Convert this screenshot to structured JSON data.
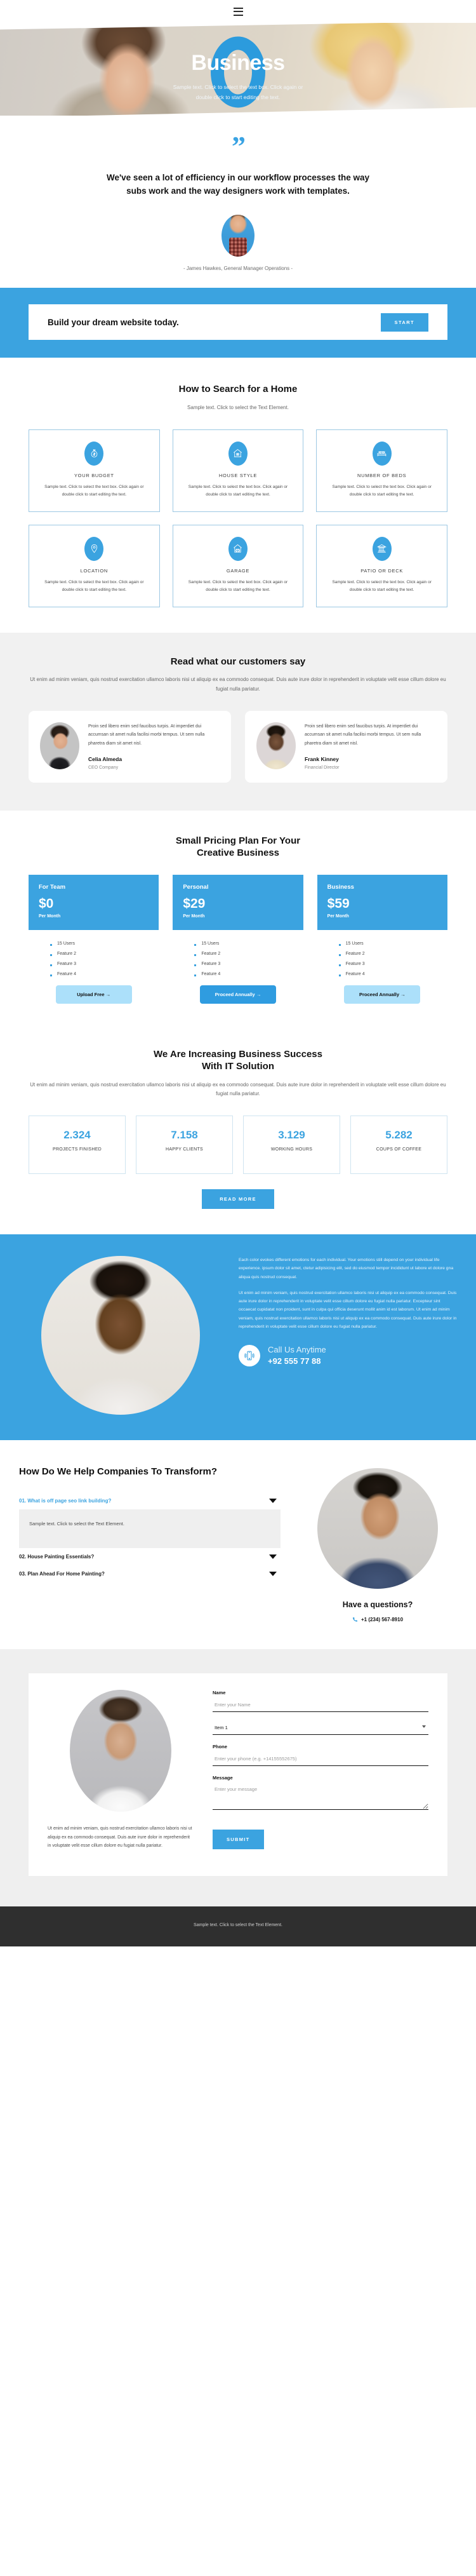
{
  "nav": {
    "menu_icon": "hamburger-menu-icon"
  },
  "hero": {
    "title": "Business",
    "subtitle": "Sample text. Click to select the text box. Click again or double click to start editing the text."
  },
  "quote": {
    "mark": "”",
    "text": "We've seen a lot of efficiency in our workflow processes the way subs work and the way designers work with templates.",
    "author": "- James Hawkes, General Manager Operations -"
  },
  "cta": {
    "text": "Build your dream website today.",
    "button": "START"
  },
  "features": {
    "title": "How to Search for a Home",
    "subtitle": "Sample text. Click to select the Text Element.",
    "body": "Sample text. Click to select the text box. Click again or double click to start editing the text.",
    "items": [
      {
        "icon": "money-bag-icon",
        "title": "YOUR BUDGET"
      },
      {
        "icon": "house-icon",
        "title": "HOUSE STYLE"
      },
      {
        "icon": "bed-icon",
        "title": "NUMBER OF BEDS"
      },
      {
        "icon": "map-pin-icon",
        "title": "LOCATION"
      },
      {
        "icon": "garage-car-icon",
        "title": "GARAGE"
      },
      {
        "icon": "patio-columns-icon",
        "title": "PATIO OR DECK"
      }
    ]
  },
  "testimonials": {
    "title": "Read what our customers say",
    "subtitle": "Ut enim ad minim veniam, quis nostrud exercitation ullamco laboris nisi ut aliquip ex ea commodo consequat. Duis aute irure dolor in reprehenderit in voluptate velit esse cillum dolore eu fugiat nulla pariatur.",
    "items": [
      {
        "text": "Proin sed libero enim sed faucibus turpis. At imperdiet dui accumsan sit amet nulla facilisi morbi tempus. Ut sem nulla pharetra diam sit amet nisl.",
        "name": "Celia Almeda",
        "role": "CEO Company"
      },
      {
        "text": "Proin sed libero enim sed faucibus turpis. At imperdiet dui accumsan sit amet nulla facilisi morbi tempus. Ut sem nulla pharetra diam sit amet nisl.",
        "name": "Frank Kinney",
        "role": "Financial Director"
      }
    ]
  },
  "pricing": {
    "title": "Small Pricing Plan For Your\nCreative Business",
    "plans": [
      {
        "name": "For Team",
        "price": "$0",
        "period": "Per Month",
        "features": [
          "15 Users",
          "Feature 2",
          "Feature 3",
          "Feature 4"
        ],
        "button": "Upload Free →"
      },
      {
        "name": "Personal",
        "price": "$29",
        "period": "Per Month",
        "features": [
          "15 Users",
          "Feature 2",
          "Feature 3",
          "Feature 4"
        ],
        "button": "Proceed Annually →"
      },
      {
        "name": "Business",
        "price": "$59",
        "period": "Per Month",
        "features": [
          "15 Users",
          "Feature 2",
          "Feature 3",
          "Feature 4"
        ],
        "button": "Proceed Annually →"
      }
    ]
  },
  "stats": {
    "title": "We Are Increasing Business Success\nWith IT Solution",
    "subtitle": "Ut enim ad minim veniam, quis nostrud exercitation ullamco laboris nisi ut aliquip ex ea commodo consequat. Duis aute irure dolor in reprehenderit in voluptate velit esse cillum dolore eu fugiat nulla pariatur.",
    "items": [
      {
        "value": "2.324",
        "label": "PROJECTS FINISHED"
      },
      {
        "value": "7.158",
        "label": "HAPPY CLIENTS"
      },
      {
        "value": "3.129",
        "label": "WORKING HOURS"
      },
      {
        "value": "5.282",
        "label": "COUPS OF COFFEE"
      }
    ],
    "button": "READ MORE"
  },
  "about": {
    "paragraph1": "Each color evokes different emotions for each individual. Your emotions still depend on your individual life experience. ipsum dolor sit amet, ctetur adipisicing elit, sed do eiusmod tempor incididunt ut labore et dolore gna aliqua quis nostrud consequat.",
    "paragraph2": "Ut enim ad minim veniam, quis nostrud exercitation ullamco laboris nisi ut aliquip ex ea commodo consequat. Duis aute irure dolor in reprehenderit in voluptate velit esse cillum dolore eu fugiat nulla pariatur. Excepteur sint occaecat cupidatat non proident, sunt in culpa qui officia deserunt mollit anim id est laborum. Ut enim ad minim veniam, quis nostrud exercitation ullamco laboris nisi ut aliquip ex ea commodo consequat. Duis aute irure dolor in reprehenderit in voluptate velit esse cillum dolore eu fugiat nulla pariatur.",
    "call_label": "Call Us Anytime",
    "call_number": "+92 555 77 88",
    "call_icon": "mobile-phone-ringing-icon"
  },
  "faq": {
    "title": "How Do We Help Companies To Transform?",
    "items": [
      {
        "question": "01. What is off page seo link building?",
        "open": true,
        "answer": "Sample text. Click to select the Text Element."
      },
      {
        "question": "02. House Painting Essentials?",
        "open": false,
        "answer": ""
      },
      {
        "question": "03. Plan Ahead For Home Painting?",
        "open": false,
        "answer": ""
      }
    ],
    "ask_title": "Have a questions?",
    "ask_phone": "+1 (234) 567-8910",
    "phone_icon": "phone-handset-icon"
  },
  "contact": {
    "blurb": "Ut enim ad minim veniam, quis nostrud exercitation ullamco laboris nisi ut aliquip ex ea commodo consequat. Duis aute irure dolor in reprehenderit in voluptate velit esse cillum dolore eu fugiat nulla pariatur.",
    "name_label": "Name",
    "name_placeholder": "Enter your Name",
    "select_value": "Item 1",
    "phone_label": "Phone",
    "phone_placeholder": "Enter your phone (e.g. +14155552675)",
    "message_label": "Message",
    "message_placeholder": "Enter your message",
    "submit": "SUBMIT"
  },
  "footer": {
    "text": "Sample text. Click to select the Text Element."
  },
  "colors": {
    "accent": "#3ba3e0",
    "accent_light": "#ace0fa",
    "dark": "#2f2f2f",
    "grey_bg": "#efefef"
  }
}
